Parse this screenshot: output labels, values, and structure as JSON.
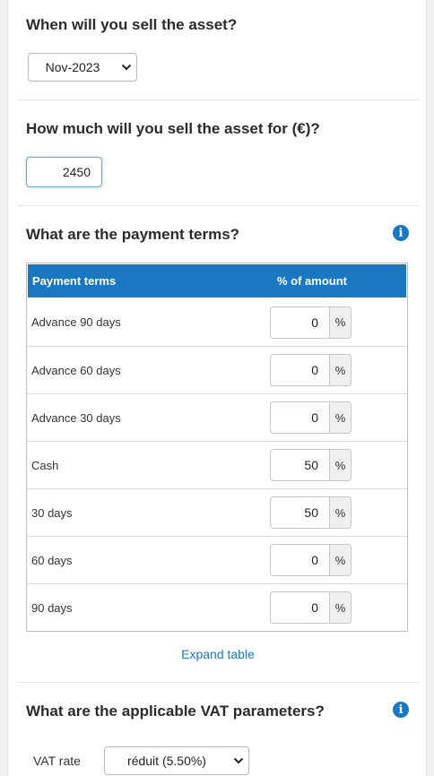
{
  "sell_date": {
    "question": "When will you sell the asset?",
    "selected": "Nov-2023"
  },
  "sell_price": {
    "question": "How much will you sell the asset for (€)?",
    "value": "2450"
  },
  "payment_terms": {
    "question": "What are the payment terms?",
    "info_icon": "info-icon",
    "header_terms": "Payment terms",
    "header_pct": "% of amount",
    "unit": "%",
    "rows": [
      {
        "label": "Advance 90 days",
        "value": "0"
      },
      {
        "label": "Advance 60 days",
        "value": "0"
      },
      {
        "label": "Advance 30 days",
        "value": "0"
      },
      {
        "label": "Cash",
        "value": "50"
      },
      {
        "label": "30 days",
        "value": "50"
      },
      {
        "label": "60 days",
        "value": "0"
      },
      {
        "label": "90 days",
        "value": "0"
      }
    ],
    "expand_label": "Expand table"
  },
  "vat": {
    "question": "What are the applicable VAT parameters?",
    "info_icon": "info-icon",
    "rate_label": "VAT rate",
    "rate_selected": "réduit (5.50%)"
  },
  "colors": {
    "accent": "#1a78c2",
    "header_bg": "#1a78c2",
    "page_bg": "#f0f0f0"
  }
}
